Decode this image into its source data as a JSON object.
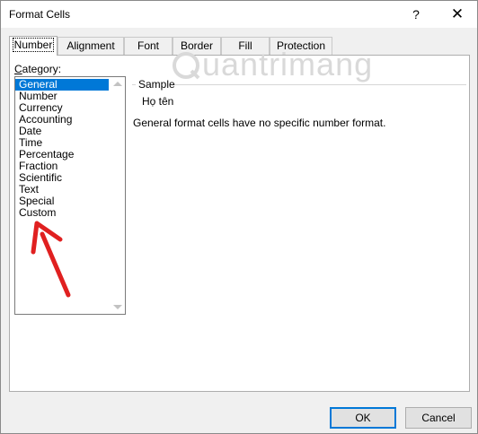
{
  "window": {
    "title": "Format Cells",
    "help_label": "?",
    "close_label": "✕"
  },
  "tabs": [
    {
      "label": "Number",
      "active": true
    },
    {
      "label": "Alignment",
      "active": false
    },
    {
      "label": "Font",
      "active": false
    },
    {
      "label": "Border",
      "active": false
    },
    {
      "label": "Fill",
      "active": false
    },
    {
      "label": "Protection",
      "active": false
    }
  ],
  "category": {
    "label_underlined": "C",
    "label_rest": "ategory:",
    "items": [
      "General",
      "Number",
      "Currency",
      "Accounting",
      "Date",
      "Time",
      "Percentage",
      "Fraction",
      "Scientific",
      "Text",
      "Special",
      "Custom"
    ],
    "selected": "General"
  },
  "sample": {
    "label": "Sample",
    "value": "Họ tên"
  },
  "description": "General format cells have no specific number format.",
  "watermark": "uantrimang",
  "buttons": {
    "ok_label": "OK",
    "cancel_label": "Cancel"
  },
  "colors": {
    "selection": "#0078d7",
    "annotation_arrow": "#e02020"
  }
}
